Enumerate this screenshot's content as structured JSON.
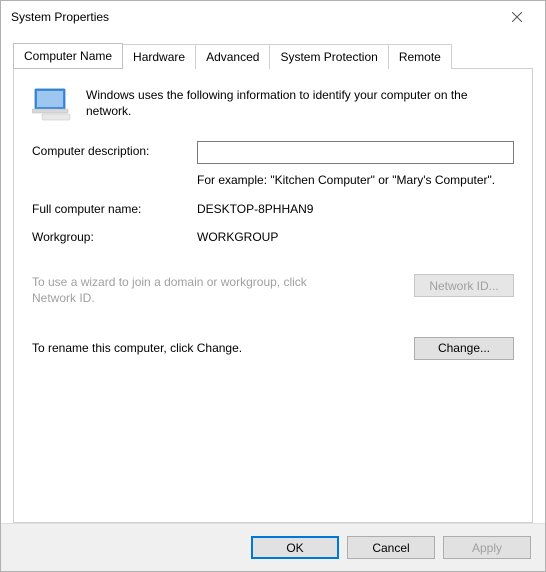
{
  "window": {
    "title": "System Properties"
  },
  "tabs": [
    {
      "label": "Computer Name",
      "active": true
    },
    {
      "label": "Hardware",
      "active": false
    },
    {
      "label": "Advanced",
      "active": false
    },
    {
      "label": "System Protection",
      "active": false
    },
    {
      "label": "Remote",
      "active": false
    }
  ],
  "intro": "Windows uses the following information to identify your computer on the network.",
  "description": {
    "label": "Computer description:",
    "value": "",
    "example": "For example: \"Kitchen Computer\" or \"Mary's Computer\"."
  },
  "fullname": {
    "label": "Full computer name:",
    "value": "DESKTOP-8PHHAN9"
  },
  "workgroup": {
    "label": "Workgroup:",
    "value": "WORKGROUP"
  },
  "wizard": {
    "text": "To use a wizard to join a domain or workgroup, click Network ID.",
    "button": "Network ID..."
  },
  "rename": {
    "text": "To rename this computer, click Change.",
    "button": "Change..."
  },
  "buttons": {
    "ok": "OK",
    "cancel": "Cancel",
    "apply": "Apply"
  }
}
